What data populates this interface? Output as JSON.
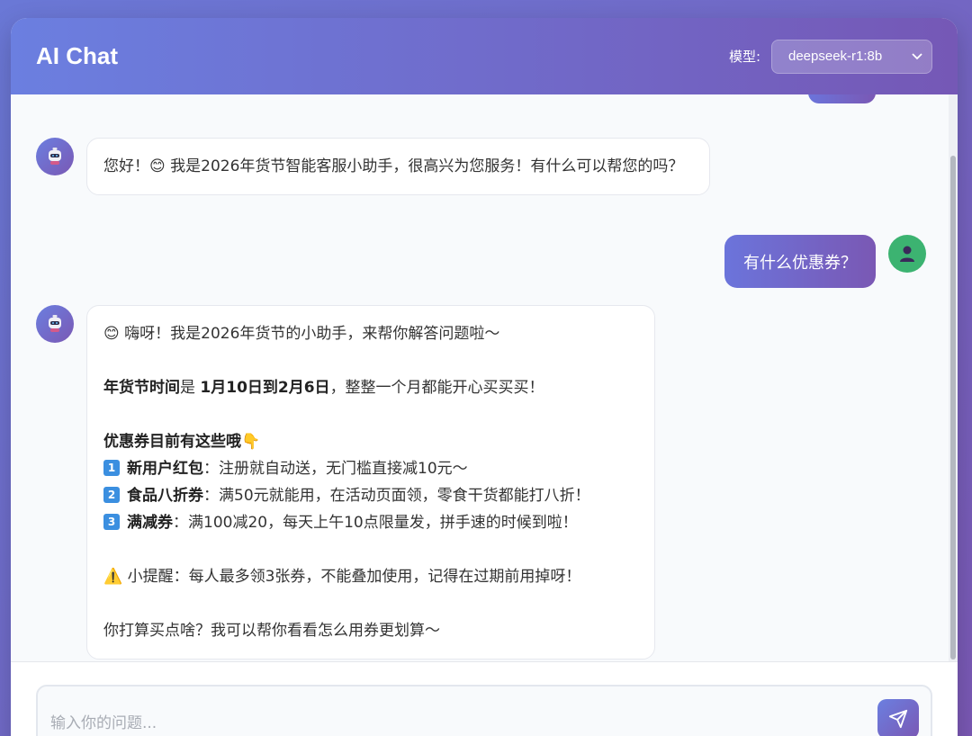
{
  "header": {
    "title": "AI Chat",
    "model_label": "模型:",
    "model_value": "deepseek-r1:8b"
  },
  "messages": [
    {
      "role": "assistant",
      "text": "您好！😊 我是2026年货节智能客服小助手，很高兴为您服务！有什么可以帮您的吗？"
    },
    {
      "role": "user",
      "text": "有什么优惠券？"
    },
    {
      "role": "assistant",
      "intro": "😊 嗨呀！我是2026年货节的小助手，来帮你解答问题啦～",
      "time_label": "年货节时间",
      "time_is": "是 ",
      "time_range": "1月10日到2月6日",
      "time_suffix": "，整整一个月都能开心买买买！",
      "coupon_heading": "优惠券目前有这些哦👇",
      "coupons": [
        {
          "num": "1",
          "name": "新用户红包",
          "desc": "：注册就自动送，无门槛直接减10元～"
        },
        {
          "num": "2",
          "name": "食品八折券",
          "desc": "：满50元就能用，在活动页面领，零食干货都能打八折！"
        },
        {
          "num": "3",
          "name": "满减券",
          "desc": "：满100减20，每天上午10点限量发，拼手速的时候到啦！"
        }
      ],
      "tip": "⚠️ 小提醒：每人最多领3张券，不能叠加使用，记得在过期前用掉呀！",
      "closing": "你打算买点啥？我可以帮你看看怎么用券更划算～"
    }
  ],
  "input": {
    "placeholder": "输入你的问题..."
  },
  "colors": {
    "accent_start": "#6b7fe0",
    "accent_end": "#7a58b4",
    "user_avatar": "#3cb371"
  }
}
